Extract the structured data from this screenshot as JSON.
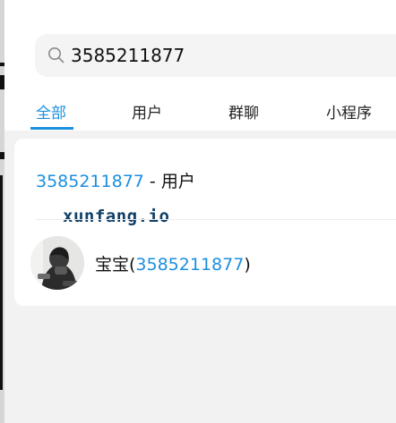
{
  "search": {
    "value": "3585211877",
    "icon": "search-icon"
  },
  "tabs": [
    {
      "label": "全部",
      "active": true
    },
    {
      "label": "用户",
      "active": false
    },
    {
      "label": "群聊",
      "active": false
    },
    {
      "label": "小程序",
      "active": false
    }
  ],
  "section": {
    "query": "3585211877",
    "separator": " - ",
    "type": "用户"
  },
  "watermark": "xunfang.io",
  "result": {
    "name_prefix": "宝宝(",
    "name_query": "3585211877",
    "name_suffix": ")"
  },
  "colors": {
    "accent": "#1b8fe0",
    "background": "#f2f2f2",
    "card": "#ffffff"
  }
}
